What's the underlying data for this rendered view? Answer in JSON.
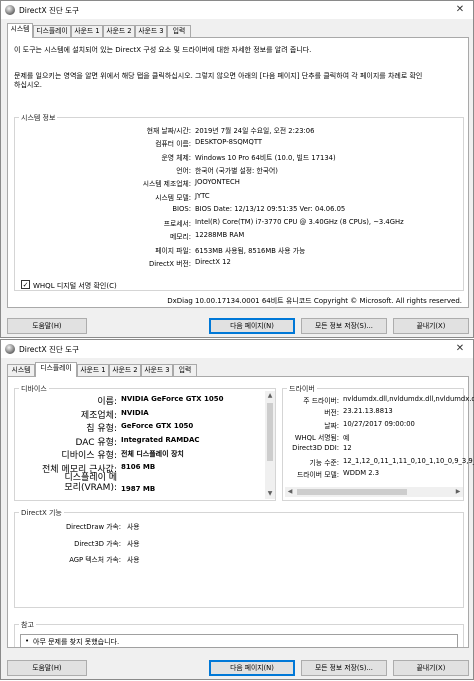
{
  "window1": {
    "title": "DirectX 진단 도구",
    "close_glyph": "✕",
    "tabs": [
      "시스템",
      "디스플레이",
      "사운드 1",
      "사운드 2",
      "사운드 3",
      "입력"
    ],
    "active_tab": 0,
    "intro": "이 도구는 시스템에 설치되어 있는 DirectX 구성 요소 및 드라이버에 대한 자세한 정보를 알려 줍니다.",
    "intro2_line1": "문제를 일으키는 영역을 알면 위에서 해당 탭을 클릭하십시오. 그렇지 않으면 아래의 [다음 페이지] 단추를 클릭하여 각 페이지를 차례로 확인",
    "intro2_line2": "하십시오.",
    "sysinfo_title": "시스템 정보",
    "rows": [
      {
        "label": "현재 날짜/시간:",
        "value": "2019년 7월 24일 수요일, 오전 2:23:06"
      },
      {
        "label": "컴퓨터 이름:",
        "value": "DESKTOP-8SQMQTT"
      },
      {
        "label": "운영 체제:",
        "value": "Windows 10 Pro 64비트 (10.0, 빌드 17134)"
      },
      {
        "label": "언어:",
        "value": "한국어 (국가별 설정: 한국어)"
      },
      {
        "label": "시스템 제조업체:",
        "value": "JOOYONTECH"
      },
      {
        "label": "시스템 모델:",
        "value": "JYTC"
      },
      {
        "label": "BIOS:",
        "value": "BIOS Date: 12/13/12 09:51:35 Ver: 04.06.05"
      },
      {
        "label": "프로세서:",
        "value": "Intel(R) Core(TM) i7-3770 CPU @ 3.40GHz (8 CPUs), ~3.4GHz"
      },
      {
        "label": "메모리:",
        "value": "12288MB RAM"
      },
      {
        "label": "페이지 파일:",
        "value": "6153MB 사용됨, 8516MB 사용 가능"
      },
      {
        "label": "DirectX 버전:",
        "value": "DirectX 12"
      }
    ],
    "whql_label": "WHQL 디지털 서명 확인(C)",
    "whql_check": "✓",
    "footer": "DxDiag 10.00.17134.0001 64비트 유니코드  Copyright © Microsoft. All rights reserved.",
    "buttons": {
      "help": "도움말(H)",
      "next": "다음 페이지(N)",
      "save": "모든 정보 저장(S)...",
      "exit": "끝내기(X)"
    }
  },
  "window2": {
    "title": "DirectX 진단 도구",
    "close_glyph": "✕",
    "tabs": [
      "시스템",
      "디스플레이",
      "사운드 1",
      "사운드 2",
      "사운드 3",
      "입력"
    ],
    "active_tab": 1,
    "device_title": "디바이스",
    "device_rows": [
      {
        "label": "이름:",
        "value": "NVIDIA GeForce GTX 1050"
      },
      {
        "label": "제조업체:",
        "value": "NVIDIA"
      },
      {
        "label": "칩 유형:",
        "value": "GeForce GTX 1050"
      },
      {
        "label": "DAC 유형:",
        "value": "Integrated RAMDAC"
      },
      {
        "label": "디바이스 유형:",
        "value": "전체 디스플레이 장치"
      },
      {
        "label": "전체 메모리 근사값:",
        "value": "8106 MB"
      }
    ],
    "display_memory_label_line1": "디스플레이 메",
    "display_memory_label_line2": "모리(VRAM):",
    "display_memory_value": "1987 MB",
    "driver_title": "드라이버",
    "driver_rows": [
      {
        "label": "주 드라이버:",
        "value": "nvldumdx.dll,nvldumdx.dll,nvldumdx.dll"
      },
      {
        "label": "버전:",
        "value": "23.21.13.8813"
      },
      {
        "label": "날짜:",
        "value": "10/27/2017 09:00:00"
      },
      {
        "label": "WHQL 서명됨:",
        "value": "예"
      },
      {
        "label": "Direct3D DDI:",
        "value": "12"
      },
      {
        "label": "기능 수준:",
        "value": "12_1,12_0,11_1,11_0,10_1,10_0,9_3,9_2"
      },
      {
        "label": "드라이버 모델:",
        "value": "WDDM 2.3"
      }
    ],
    "features_title": "DirectX 기능",
    "feature_rows": [
      {
        "label": "DirectDraw 가속:",
        "value": "사용"
      },
      {
        "label": "Direct3D 가속:",
        "value": "사용"
      },
      {
        "label": "AGP 텍스처 가속:",
        "value": "사용"
      }
    ],
    "notes_title": "참고",
    "notes_text": "아무 문제를 찾지 못했습니다.",
    "bullet": "•",
    "buttons": {
      "help": "도움말(H)",
      "next": "다음 페이지(N)",
      "save": "모든 정보 저장(S)...",
      "exit": "끝내기(X)"
    }
  },
  "arrows": {
    "up": "▲",
    "down": "▼",
    "left": "◀",
    "right": "▶"
  },
  "colors": {
    "accent": "#0078d7",
    "panel": "#ffffff",
    "chrome": "#f0f0f0",
    "border": "#a9a9a9"
  }
}
